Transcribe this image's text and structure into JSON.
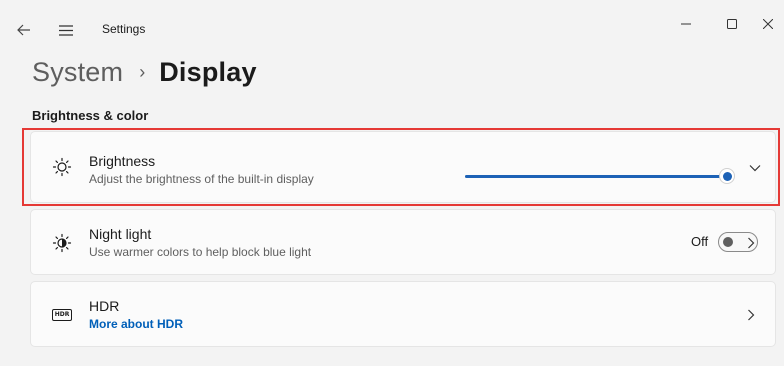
{
  "window": {
    "title": "Settings",
    "back_icon": "back-arrow-icon",
    "menu_icon": "hamburger-menu-icon",
    "controls": [
      "minimize-icon",
      "maximize-icon",
      "close-icon"
    ]
  },
  "breadcrumb": {
    "parent": "System",
    "separator": "›",
    "current": "Display"
  },
  "section": {
    "title": "Brightness & color"
  },
  "brightness": {
    "icon": "sun-icon",
    "title": "Brightness",
    "subtitle": "Adjust the brightness of the built-in display",
    "value_fraction": 1.0,
    "expand_icon": "chevron-down-icon",
    "highlighted": true,
    "highlight_color": "#e53935"
  },
  "night_light": {
    "icon": "night-light-icon",
    "title": "Night light",
    "subtitle": "Use warmer colors to help block blue light",
    "state_label": "Off",
    "enabled": false,
    "nav_icon": "chevron-right-icon"
  },
  "hdr": {
    "icon_text": "HDR",
    "title": "HDR",
    "link": "More about HDR",
    "nav_icon": "chevron-right-icon"
  },
  "colors": {
    "accent": "#1d62b6",
    "link": "#005fb8",
    "background": "#f3f3f3",
    "card": "#fbfbfb"
  }
}
